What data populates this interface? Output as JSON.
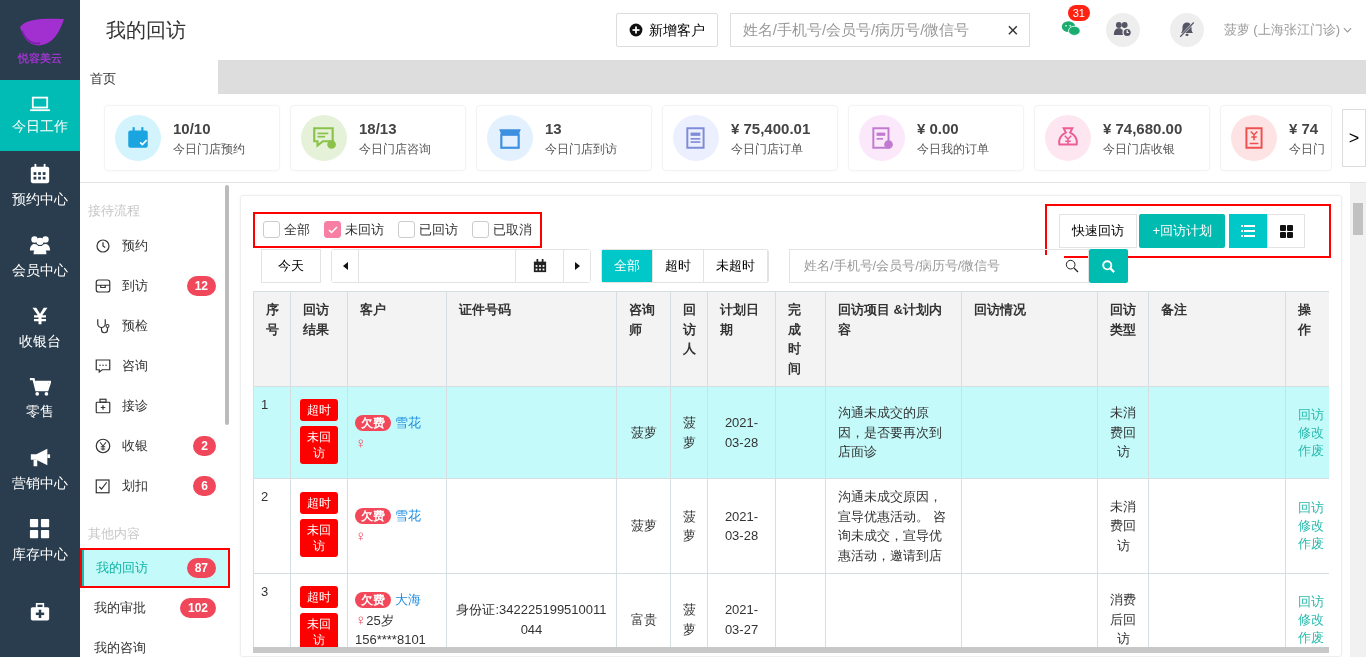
{
  "logo": {
    "text": "悦容美云"
  },
  "nav": [
    {
      "label": "今日工作",
      "selected": true
    },
    {
      "label": "预约中心",
      "selected": false
    },
    {
      "label": "会员中心",
      "selected": false
    },
    {
      "label": "收银台",
      "selected": false
    },
    {
      "label": "零售",
      "selected": false
    },
    {
      "label": "营销中心",
      "selected": false
    },
    {
      "label": "库存中心",
      "selected": false
    },
    {
      "selected": false
    }
  ],
  "header": {
    "title": "我的回访",
    "add_button": "新增客户",
    "search": {
      "placeholder": "姓名/手机号/会员号/病历号/微信号",
      "clear": "×"
    },
    "message_count": "31",
    "user": "菠萝 (上海张江门诊)"
  },
  "tabs": [
    {
      "label": "首页",
      "selected": true
    }
  ],
  "stats": [
    {
      "value": "10/10",
      "label": "今日门店预约"
    },
    {
      "value": "18/13",
      "label": "今日门店咨询"
    },
    {
      "value": "13",
      "label": "今日门店到访"
    },
    {
      "value": "¥ 75,400.01",
      "label": "今日门店订单"
    },
    {
      "value": "¥ 0.00",
      "label": "今日我的订单"
    },
    {
      "value": "¥ 74,680.00",
      "label": "今日门店收银"
    },
    {
      "value": "¥ 74",
      "label": "今日门"
    }
  ],
  "stats_next": ">",
  "submenu": [
    {
      "title": "接待流程",
      "items": [
        {
          "label": "预约",
          "selected": false,
          "highlighted": false
        },
        {
          "label": "到访",
          "badge": "12",
          "selected": false,
          "highlighted": false
        },
        {
          "label": "预检",
          "selected": false,
          "highlighted": false
        },
        {
          "label": "咨询",
          "selected": false,
          "highlighted": false
        },
        {
          "label": "接诊",
          "selected": false,
          "highlighted": false
        },
        {
          "label": "收银",
          "badge": "2",
          "selected": false,
          "highlighted": false
        },
        {
          "label": "划扣",
          "badge": "6",
          "selected": false,
          "highlighted": false
        }
      ]
    },
    {
      "title": "其他内容",
      "items": [
        {
          "label": "我的回访",
          "badge": "87",
          "selected": true,
          "highlighted": true
        },
        {
          "label": "我的审批",
          "badge": "102",
          "selected": false,
          "highlighted": false
        },
        {
          "label": "我的咨询",
          "selected": false,
          "highlighted": false
        }
      ]
    }
  ],
  "filters": {
    "highlighted": true,
    "options": [
      {
        "label": "全部",
        "checked": false
      },
      {
        "label": "未回访",
        "checked": true
      },
      {
        "label": "已回访",
        "checked": false
      },
      {
        "label": "已取消",
        "checked": false
      }
    ]
  },
  "toolbar": {
    "today": "今天",
    "ranges": [
      {
        "label": "全部",
        "selected": true
      },
      {
        "label": "超时",
        "selected": false
      },
      {
        "label": "未超时",
        "selected": false
      }
    ],
    "search_placeholder": "姓名/手机号/会员号/病历号/微信号"
  },
  "actions": {
    "highlighted": true,
    "quick": "快速回访",
    "plan": "+回访计划",
    "views": [
      {
        "selected": true
      },
      {
        "selected": false
      }
    ]
  },
  "table": {
    "columns": [
      "序号",
      "回访结果",
      "客户",
      "证件号码",
      "咨询师",
      "回访人",
      "计划日期",
      "完成时间",
      "回访项目 &计划内容",
      "回访情况",
      "回访类型",
      "备注",
      "操作"
    ],
    "rows": [
      {
        "index": "1",
        "selected": true,
        "results": [
          "超时",
          "未回访"
        ],
        "tag": "欠费",
        "customer": "雪花",
        "gender": "♀",
        "consultant": "菠萝",
        "visitor": "菠萝",
        "plan_date": "2021-03-28",
        "content": "沟通未成交的原因，是否要再次到店面诊",
        "type": "未消费回访",
        "operations": [
          "回访",
          "修改",
          "作废"
        ]
      },
      {
        "index": "2",
        "selected": false,
        "results": [
          "超时",
          "未回访"
        ],
        "tag": "欠费",
        "customer": "雪花",
        "gender": "♀",
        "consultant": "菠萝",
        "visitor": "菠萝",
        "plan_date": "2021-03-28",
        "content": "沟通未成交原因，宣导优惠活动。 咨询未成交，宣导优惠活动，邀请到店",
        "type": "未消费回访",
        "operations": [
          "回访",
          "修改",
          "作废"
        ]
      },
      {
        "index": "3",
        "selected": false,
        "results": [
          "超时",
          "未回访"
        ],
        "tag": "欠费",
        "customer": "大海",
        "gender": "♀",
        "age": "25岁",
        "phone": "156****8101",
        "id_number": "身份证:342225199510011044",
        "consultant": "富贵",
        "visitor": "菠萝",
        "plan_date": "2021-03-27",
        "type": "消费后回访",
        "operations": [
          "回访",
          "修改",
          "作废"
        ]
      }
    ]
  }
}
